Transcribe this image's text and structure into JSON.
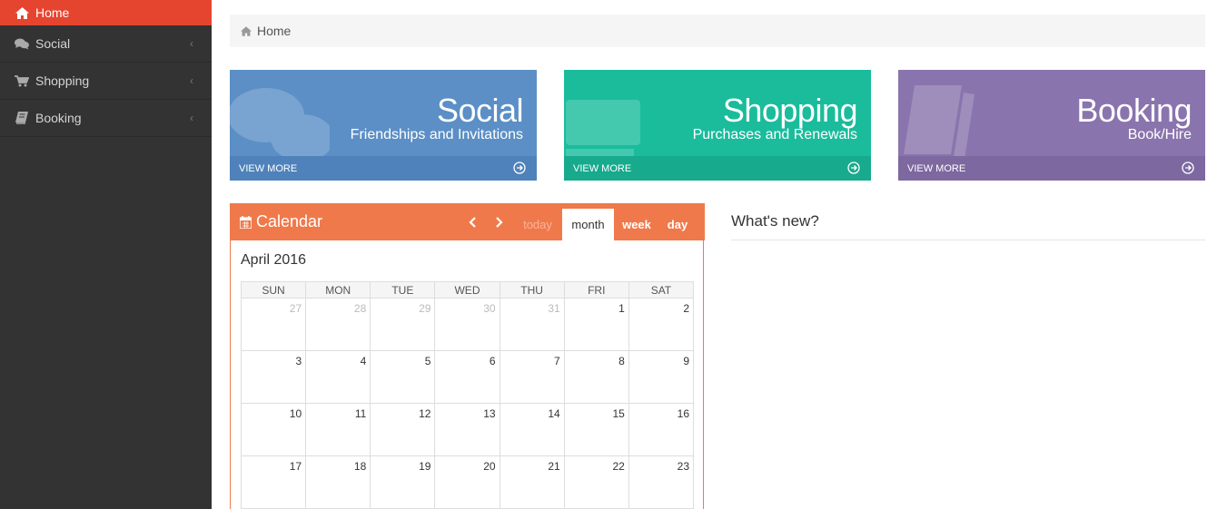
{
  "sidebar": {
    "items": [
      {
        "label": "Home",
        "icon": "home-icon",
        "active": true
      },
      {
        "label": "Social",
        "icon": "comments-icon"
      },
      {
        "label": "Shopping",
        "icon": "cart-icon"
      },
      {
        "label": "Booking",
        "icon": "book-icon"
      }
    ]
  },
  "breadcrumb": {
    "label": "Home"
  },
  "tiles": [
    {
      "title": "Social",
      "subtitle": "Friendships and Invitations",
      "link": "VIEW MORE"
    },
    {
      "title": "Shopping",
      "subtitle": "Purchases and Renewals",
      "link": "VIEW MORE"
    },
    {
      "title": "Booking",
      "subtitle": "Book/Hire",
      "link": "VIEW MORE"
    }
  ],
  "calendar": {
    "title": "Calendar",
    "buttons": {
      "today": "today",
      "month": "month",
      "week": "week",
      "day": "day"
    },
    "period": "April 2016",
    "weekdays": [
      "SUN",
      "MON",
      "TUE",
      "WED",
      "THU",
      "FRI",
      "SAT"
    ],
    "weeks": [
      [
        "27",
        "28",
        "29",
        "30",
        "31",
        "1",
        "2"
      ],
      [
        "3",
        "4",
        "5",
        "6",
        "7",
        "8",
        "9"
      ],
      [
        "10",
        "11",
        "12",
        "13",
        "14",
        "15",
        "16"
      ],
      [
        "17",
        "18",
        "19",
        "20",
        "21",
        "22",
        "23"
      ]
    ]
  },
  "news": {
    "title": "What's new?"
  },
  "colors": {
    "sidebar_bg": "#333333",
    "active_item": "#e5452f",
    "social": "#5b8fc6",
    "shopping": "#1abc9c",
    "booking": "#8a74ad",
    "calendar_header": "#f0794b"
  }
}
